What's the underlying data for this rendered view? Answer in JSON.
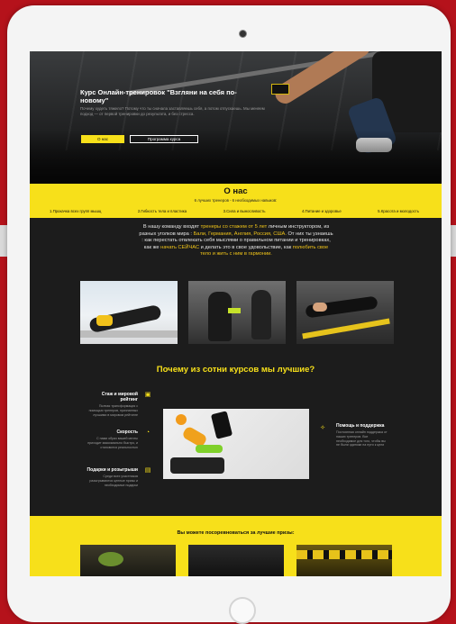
{
  "hero": {
    "title": "Курс Онлайн-тренировок \"Взгляни на себя по-новому\"",
    "subtitle": "Почему худеть тяжело? Потому что ты сначала заставляешь себя, а потом отпускаешь. Мы меняем подход — от первой тренировки до результата, и без стресса.",
    "about_button": "О нас",
    "program_button": "Программа курса"
  },
  "about": {
    "heading": "О нас",
    "subheading": "6 лучших тренеров - 6 необходимых навыков:",
    "items": [
      "1.Прокачка всех групп мышц",
      "2.Гибкость тела и пластика",
      "3.Сила и выносливость",
      "4.Питание и здоровье",
      "5.Красота и молодость"
    ],
    "intro_1": "В нашу команду входят ",
    "intro_hl_1": "тренеры со стажем от 5 лет",
    "intro_2": " личным инструктором, из разных уголков мира : ",
    "intro_hl_2": "Бали, Германия, Англия, Россия, США.",
    "intro_3": " От них ты узнаешь : как перестать отвлекать себя мыслями о правильном питании и тренировках, как же ",
    "intro_hl_3": "начать СЕЙЧАС",
    "intro_4": " и делать это в свое удовольствие, как ",
    "intro_hl_4": "полюбить свое тело и жить с ним в гармонии."
  },
  "why": {
    "title": "Почему из сотни курсов мы лучшие?",
    "features": [
      {
        "title": "Стаж и мировой рейтинг",
        "desc": "Полная трансформация с помощью тренеров, признанных лучшими в мировом рейтинге",
        "icon": "certificate-icon"
      },
      {
        "title": "Скорость",
        "desc": "С нами образ вашей мечты приходит максимально быстро, и становится реальностью",
        "icon": "speed-icon"
      },
      {
        "title": "Подарки и розыгрыши",
        "desc": "Среди всех участников разыгрываются ценные призы и необходимые подарки",
        "icon": "gift-icon"
      },
      {
        "title": "Помощь и поддержка",
        "desc": "Постоянная онлайн поддержка от наших тренеров. Все необходимое для того, чтобы вы не были одиноки на пути к цели",
        "icon": "handshake-icon"
      }
    ]
  },
  "prizes": {
    "title": "Вы можете посоревноваться за лучшие призы:"
  },
  "colors": {
    "accent": "#f7e01a",
    "dark": "#1c1c1c"
  }
}
